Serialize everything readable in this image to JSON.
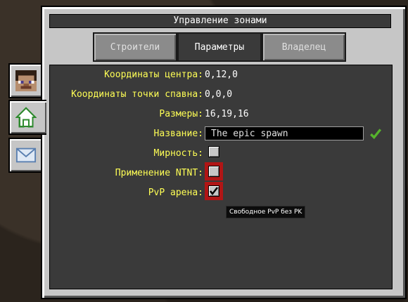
{
  "window": {
    "title": "Управление зонами"
  },
  "tabs": [
    {
      "label": "Строители",
      "active": false
    },
    {
      "label": "Параметры",
      "active": true
    },
    {
      "label": "Владелец",
      "active": false
    }
  ],
  "side_tabs": [
    {
      "icon": "player-face-icon"
    },
    {
      "icon": "home-icon",
      "active": true
    },
    {
      "icon": "envelope-icon"
    }
  ],
  "params": {
    "center_label": "Координаты центра:",
    "center_value": "0,12,0",
    "spawn_label": "Координаты точки спавна:",
    "spawn_value": "0,0,0",
    "size_label": "Размеры:",
    "size_value": "16,19,16",
    "name_label": "Название:",
    "name_value": "The epic spawn",
    "peace_label": "Мирность:",
    "peace_checked": false,
    "tnt_label": "Применение NTNT:",
    "tnt_checked": false,
    "pvp_label": "PvP арена:",
    "pvp_checked": true
  },
  "tooltip": {
    "text": "Свободное PvP без PK"
  },
  "colors": {
    "label": "#ffff55",
    "confirm": "#56b32c",
    "highlight": "#b01515"
  }
}
